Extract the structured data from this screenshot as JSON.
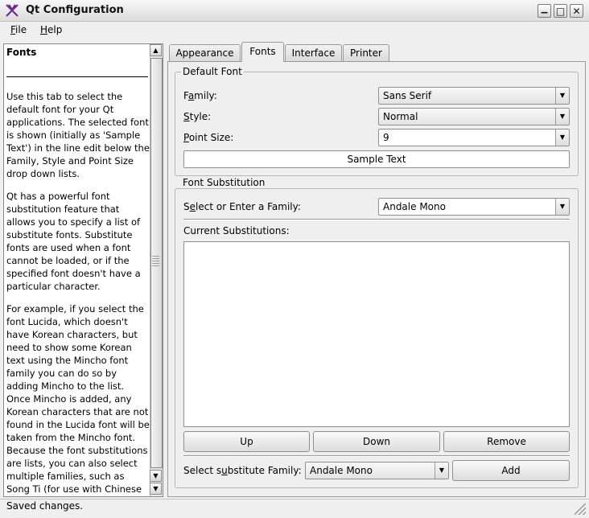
{
  "window": {
    "title": "Qt Configuration",
    "minimize_glyph": "▁",
    "maximize_glyph": "□",
    "close_glyph": "✕"
  },
  "menu": {
    "file": {
      "mnemonic": "F",
      "rest": "ile"
    },
    "help": {
      "mnemonic": "H",
      "rest": "elp"
    }
  },
  "help_pane": {
    "title": "Fonts",
    "paragraphs": [
      "Use this tab to select the default font for your Qt applications. The selected font is shown (initially as 'Sample Text') in the line edit below the Family, Style and Point Size drop down lists.",
      "Qt has a powerful font substitution feature that allows you to specify a list of substitute fonts. Substitute fonts are used when a font cannot be loaded, or if the specified font doesn't have a particular character.",
      "For example, if you select the font Lucida, which doesn't have Korean characters, but need to show some Korean text using the Mincho font family you can do so by adding Mincho to the list. Once Mincho is added, any Korean characters that are not found in the Lucida font will be taken from the Mincho font. Because the font substitutions are lists, you can also select multiple families, such as Song Ti (for use with Chinese text)."
    ]
  },
  "tabs": [
    "Appearance",
    "Fonts",
    "Interface",
    "Printer"
  ],
  "active_tab": "Fonts",
  "default_font": {
    "group_title": "Default Font",
    "family_label": {
      "pre": "F",
      "mnemonic": "a",
      "post": "mily:"
    },
    "family_value": "Sans Serif",
    "style_label": {
      "pre": "",
      "mnemonic": "S",
      "post": "tyle:"
    },
    "style_value": "Normal",
    "size_label": {
      "pre": "",
      "mnemonic": "P",
      "post": "oint Size:"
    },
    "size_value": "9",
    "sample_text": "Sample Text"
  },
  "font_substitution": {
    "group_title": "Font Substitution",
    "select_family_label": {
      "pre": "S",
      "mnemonic": "e",
      "post": "lect or Enter a Family:"
    },
    "select_family_value": "Andale Mono",
    "current_label": "Current Substitutions:",
    "substitutions": [],
    "up_label": "Up",
    "down_label": "Down",
    "remove_label": "Remove",
    "substitute_label": {
      "pre": "Select s",
      "mnemonic": "u",
      "post": "bstitute Family:"
    },
    "substitute_value": "Andale Mono",
    "add_label": "Add"
  },
  "status": {
    "text": "Saved changes."
  },
  "colors": {
    "logo": "#6b2f8f"
  }
}
